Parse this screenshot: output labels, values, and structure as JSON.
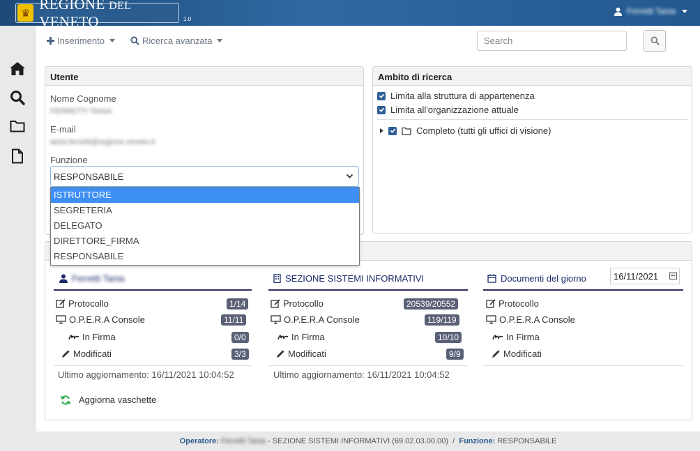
{
  "header": {
    "brand_region": "REGIONE",
    "brand_del": "DEL",
    "brand_veneto": "VENETO",
    "version": "1.0",
    "user_name": "Ferretti Tania"
  },
  "toolbar": {
    "insert_label": "Inserimento",
    "advanced_search_label": "Ricerca avanzata",
    "search_placeholder": "Search"
  },
  "user_panel": {
    "title": "Utente",
    "name_label": "Nome Cognome",
    "name_value": "FERRETTI TANIA",
    "email_label": "E-mail",
    "email_value": "tania.ferretti@regione.veneto.it",
    "function_label": "Funzione",
    "function_value": "RESPONSABILE",
    "function_options": [
      "ISTRUTTORE",
      "SEGRETERIA",
      "DELEGATO",
      "DIRETTORE_FIRMA",
      "RESPONSABILE"
    ],
    "highlighted_option": "ISTRUTTORE"
  },
  "scope_panel": {
    "title": "Ambito di ricerca",
    "option1": "Limita alla struttura di appartenenza",
    "option2": "Limita all'organizzazione attuale",
    "tree_item": "Completo (tutti gli uffici di visione)"
  },
  "trays": {
    "col1": {
      "title": "Ferretti Tania",
      "protocollo": "Protocollo",
      "protocollo_badge": "1/14",
      "opera": "O.P.E.R.A Console",
      "opera_badge": "11/11",
      "firma": "In Firma",
      "firma_badge": "0/0",
      "modificati": "Modificati",
      "modificati_badge": "3/3",
      "updated": "Ultimo aggiornamento: 16/11/2021 10:04:52"
    },
    "col2": {
      "title": "SEZIONE SISTEMI INFORMATIVI",
      "protocollo": "Protocollo",
      "protocollo_badge": "20539/20552",
      "opera": "O.P.E.R.A Console",
      "opera_badge": "119/119",
      "firma": "In Firma",
      "firma_badge": "10/10",
      "modificati": "Modificati",
      "modificati_badge": "9/9",
      "updated": "Ultimo aggiornamento: 16/11/2021 10:04:52"
    },
    "col3": {
      "title": "Documenti del giorno",
      "date": "16/11/2021",
      "protocollo": "Protocollo",
      "opera": "O.P.E.R.A Console",
      "firma": "In Firma",
      "modificati": "Modificati"
    },
    "refresh_label": "Aggiorna vaschette"
  },
  "footer": {
    "operator_label": "Operatore:",
    "operator_name": "Ferretti Tania",
    "office": "- SEZIONE SISTEMI INFORMATIVI (69.02.03.00.00)",
    "divider": "/",
    "function_label": "Funzione:",
    "function_value": "RESPONSABILE"
  },
  "colors": {
    "accent": "#2f5f96",
    "header": "#23588f",
    "badge": "#5a6076",
    "highlight": "#3d8ff5"
  }
}
